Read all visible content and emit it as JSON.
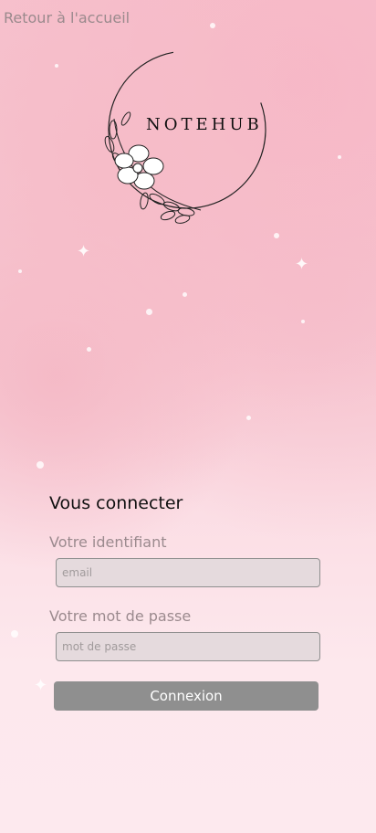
{
  "nav": {
    "back_label": "Retour à l'accueil"
  },
  "brand": {
    "name": "NOTEHUB"
  },
  "login": {
    "title": "Vous connecter",
    "id_label": "Votre identifiant",
    "id_placeholder": "email",
    "pwd_label": "Votre mot de passe",
    "pwd_placeholder": "mot de passe",
    "submit_label": "Connexion"
  },
  "colors": {
    "background_top": "#f7c3cf",
    "background_bottom": "#fde9ee",
    "button": "#8f8f8f",
    "input_bg": "#e5dadd"
  }
}
